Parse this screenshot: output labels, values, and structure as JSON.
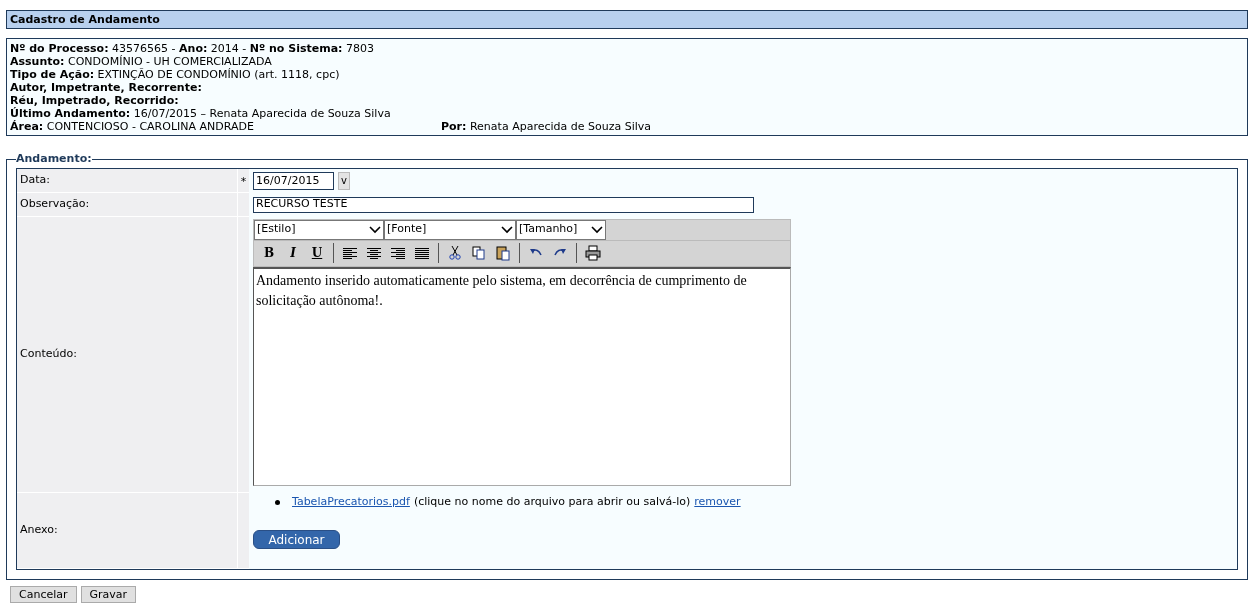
{
  "header": {
    "title": "Cadastro de Andamento"
  },
  "info": {
    "lines": [
      [
        "**Nº do Processo:** 43576565 - **Ano:** 2014 - **Nº no Sistema:** 7803"
      ],
      [
        "**Assunto:** CONDOMÍNIO - UH COMERCIALIZADA"
      ],
      [
        "**Tipo de Ação:** EXTINÇÃO DE CONDOMÍNIO (art. 1118, cpc)"
      ],
      [
        "**Autor, Impetrante, Recorrente:**"
      ],
      [
        "**Réu, Impetrado, Recorrido:**"
      ],
      [
        "**Último Andamento:** 16/07/2015 – Renata Aparecida de Souza Silva"
      ],
      [
        "**Área:** CONTENCIOSO - CAROLINA ANDRADE",
        "**Por:** Renata Aparecida de Souza Silva"
      ]
    ]
  },
  "form": {
    "legend": "Andamento:",
    "fields": [
      {
        "kind": "date",
        "label": "Data:",
        "marker": "*",
        "value": "16/07/2015",
        "picker": "v"
      },
      {
        "kind": "text",
        "label": "Observação:",
        "value": "RECURSO TESTE"
      },
      {
        "kind": "editor",
        "label": "Conteúdo:",
        "selects": [
          "[Estilo]",
          "[Fonte]",
          "[Tamanho]"
        ],
        "format_buttons": [
          "B",
          "I",
          "U"
        ],
        "content": "Andamento inserido automaticamente pelo sistema, em decorrência de cumprimento de solicitação autônoma!."
      },
      {
        "kind": "attachment",
        "label": "Anexo:",
        "files": [
          {
            "name": "TabelaPrecatorios.pdf",
            "note": "(clique no nome do arquivo para abrir ou salvá-lo)",
            "remove": "remover"
          }
        ],
        "add_button": "Adicionar"
      }
    ]
  },
  "buttons": [
    "Cancelar",
    "Gravar"
  ]
}
